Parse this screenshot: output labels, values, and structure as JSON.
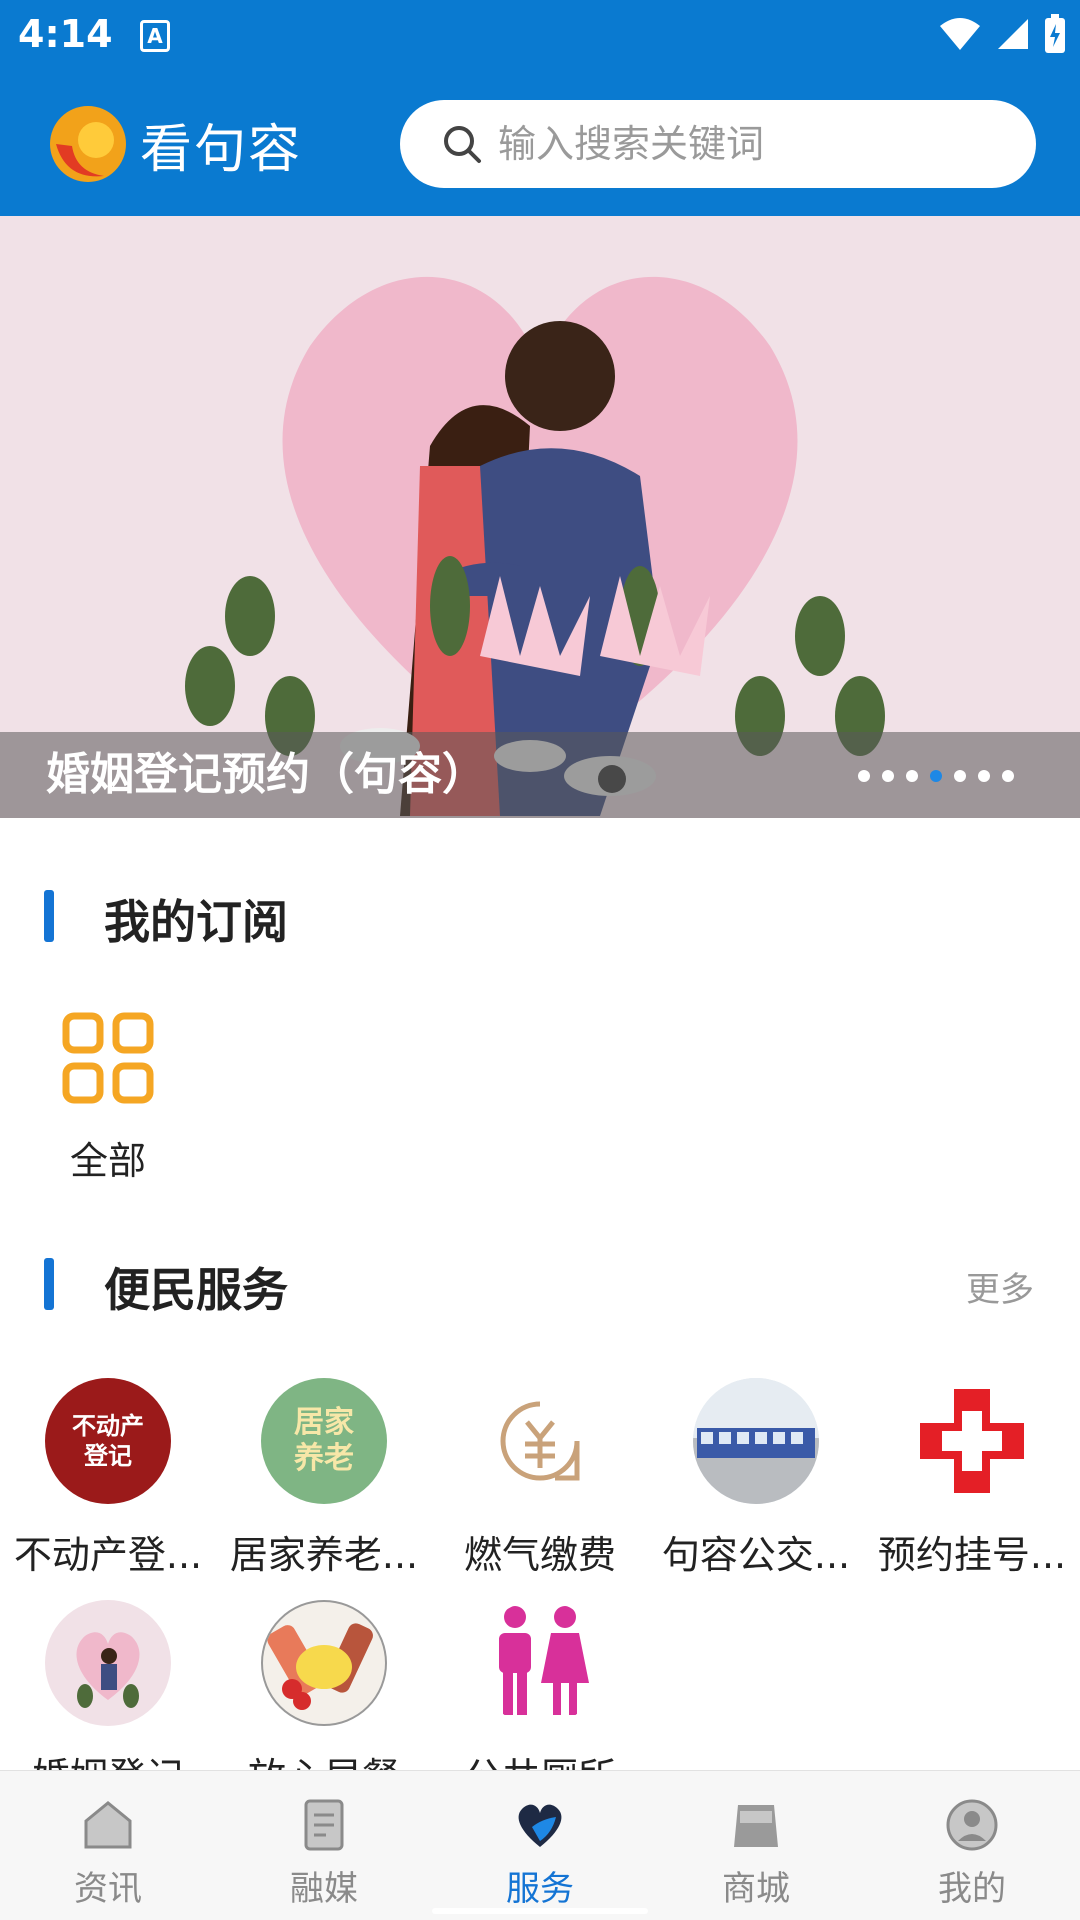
{
  "status_bar": {
    "time": "4:14",
    "notification_icon": "A"
  },
  "header": {
    "app_title": "看句容",
    "search_placeholder": "输入搜索关键词"
  },
  "banner": {
    "caption": "婚姻登记预约（句容）",
    "slide_count": 7,
    "active_slide": 4
  },
  "subscription": {
    "title": "我的订阅",
    "items": [
      {
        "label": "全部",
        "icon": "grid-icon"
      }
    ]
  },
  "services": {
    "title": "便民服务",
    "more_label": "更多",
    "items": [
      {
        "label": "不动产登...",
        "icon_text": "不动产\n登记",
        "icon": "real-estate-icon"
      },
      {
        "label": "居家养老...",
        "icon_text": "居家\n养老",
        "icon": "home-care-icon"
      },
      {
        "label": "燃气缴费",
        "icon": "gas-payment-icon"
      },
      {
        "label": "句容公交...",
        "icon": "bus-photo-icon"
      },
      {
        "label": "预约挂号...",
        "icon": "red-cross-icon"
      },
      {
        "label": "婚姻登记",
        "icon": "marriage-icon"
      },
      {
        "label": "放心早餐",
        "icon": "breakfast-icon"
      },
      {
        "label": "公共厕所",
        "icon": "toilet-icon"
      }
    ]
  },
  "bottom_nav": {
    "items": [
      {
        "label": "资讯",
        "icon": "home-icon"
      },
      {
        "label": "融媒",
        "icon": "document-icon"
      },
      {
        "label": "服务",
        "icon": "heart-service-icon",
        "active": true
      },
      {
        "label": "商城",
        "icon": "shop-icon"
      },
      {
        "label": "我的",
        "icon": "profile-icon"
      }
    ]
  },
  "colors": {
    "primary": "#0a7ad0",
    "accent": "#1474d4",
    "orange": "#f5a623",
    "nav_inactive": "#8a8a8a"
  }
}
